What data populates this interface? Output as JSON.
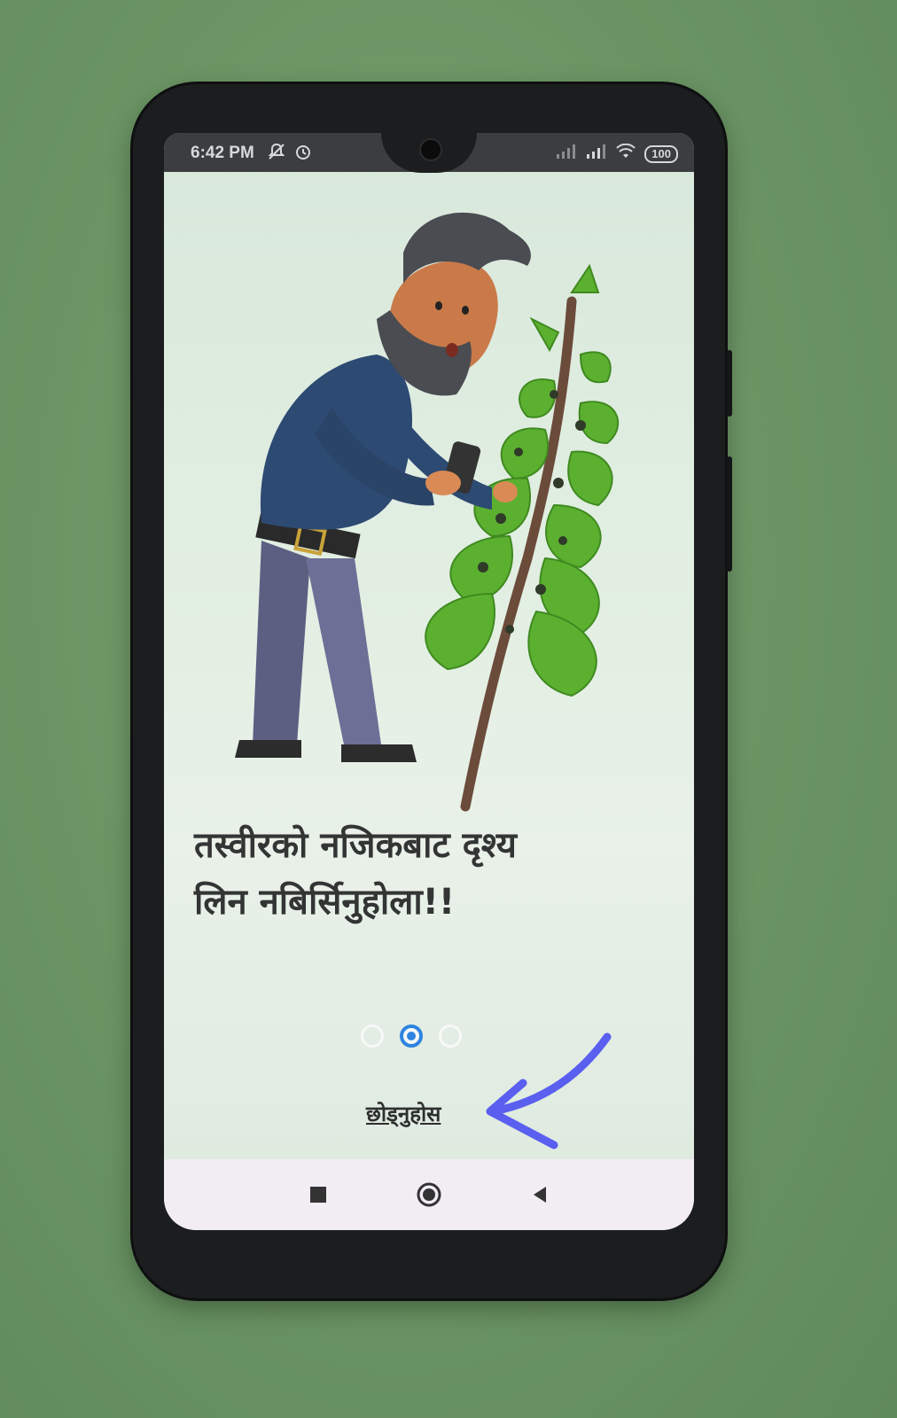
{
  "status_bar": {
    "time": "6:42 PM",
    "battery": "100",
    "icons": [
      "mute-notifications-icon",
      "alarm-icon",
      "signal-icon",
      "signal-icon",
      "wifi-icon",
      "battery-icon"
    ]
  },
  "onboarding": {
    "headline_line1": "तस्वीरको नजिकबाट दृश्य",
    "headline_line2": "लिन नबिर्सिनुहोला!!",
    "pages_total": 3,
    "current_page": 2,
    "skip_label": "छोड्नुहोस"
  },
  "nav_bar": {
    "buttons": [
      "recents-icon",
      "home-icon",
      "back-icon"
    ]
  },
  "colors": {
    "accent": "#2e84e0",
    "annotation_arrow": "#5a5ff0",
    "screen_bg": "#e3efe3"
  }
}
